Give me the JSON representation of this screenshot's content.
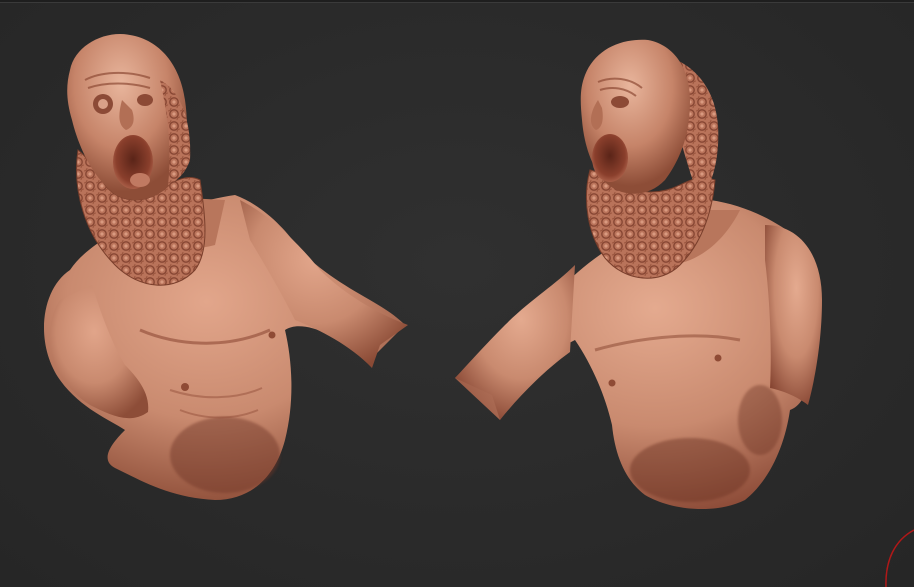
{
  "scene": {
    "background_color": "#2b2b2b",
    "material_color": "#c98a6f",
    "material_shadow": "#7a3f2c",
    "material_highlight": "#e8b59c",
    "gizmo_color": "#b01818",
    "objects": [
      {
        "name": "screaming-bearded-bust-front-three-quarter"
      },
      {
        "name": "screaming-bearded-bust-side-three-quarter"
      }
    ]
  }
}
